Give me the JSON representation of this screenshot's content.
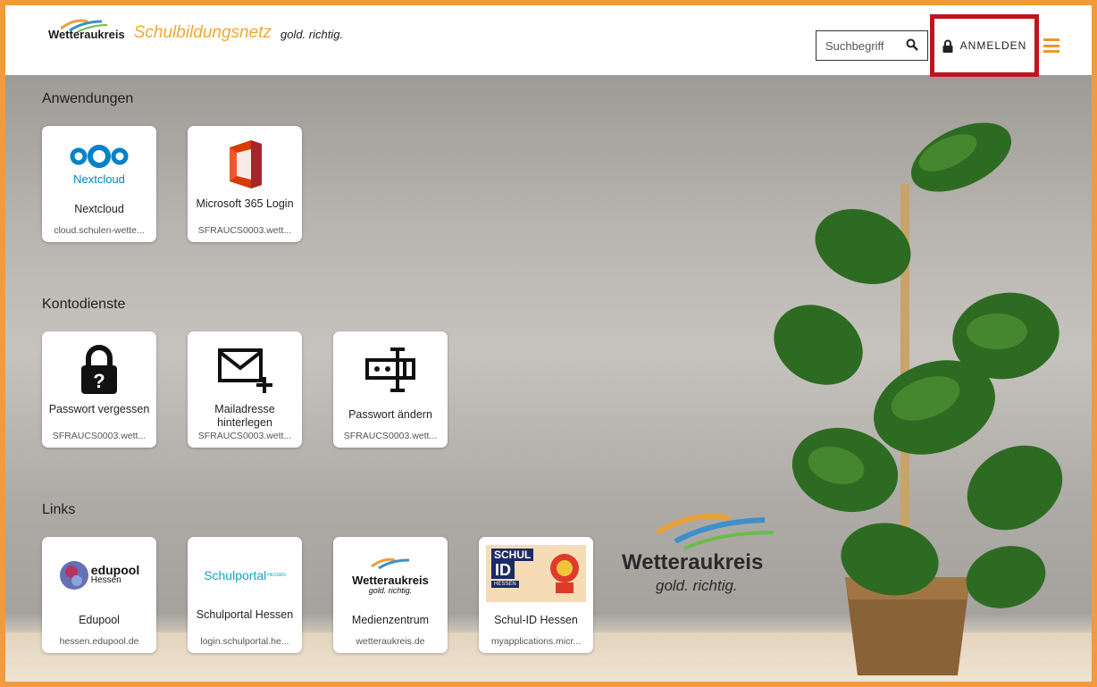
{
  "header": {
    "brand": "Wetteraukreis",
    "school": "Schulbildungsnetz",
    "slogan": "gold. richtig.",
    "search_placeholder": "Suchbegriff",
    "login_label": "ANMELDEN"
  },
  "sections": {
    "apps": {
      "title": "Anwendungen",
      "items": [
        {
          "label": "Nextcloud",
          "url": "cloud.schulen-wette..."
        },
        {
          "label": "Microsoft 365 Login",
          "url": "SFRAUCS0003.wett..."
        }
      ]
    },
    "account": {
      "title": "Kontodienste",
      "items": [
        {
          "label": "Passwort vergessen",
          "url": "SFRAUCS0003.wett..."
        },
        {
          "label": "Mailadresse hinterlegen",
          "url": "SFRAUCS0003.wett..."
        },
        {
          "label": "Passwort ändern",
          "url": "SFRAUCS0003.wett..."
        }
      ]
    },
    "links": {
      "title": "Links",
      "items": [
        {
          "label": "Edupool",
          "url": "hessen.edupool.de"
        },
        {
          "label": "Schulportal Hessen",
          "url": "login.schulportal.he..."
        },
        {
          "label": "Medienzentrum",
          "url": "wetteraukreis.de"
        },
        {
          "label": "Schul-ID Hessen",
          "url": "myapplications.micr..."
        }
      ]
    }
  },
  "icon_text": {
    "nextcloud": "Nextcloud",
    "edupool": "edupool",
    "edupool_sub": "Hessen",
    "schulportal": "Schulportal",
    "schulportal_sup": "HESSEN",
    "medien_brand": "Wetteraukreis",
    "medien_slogan": "gold. richtig.",
    "schulid_1": "SCHUL",
    "schulid_2": "ID",
    "schulid_3": "HESSEN"
  },
  "background": {
    "brand": "Wetteraukreis",
    "slogan": "gold. richtig."
  },
  "colors": {
    "accent": "#f39a3c",
    "highlight": "#c0141c",
    "school_text": "#f0a830"
  }
}
